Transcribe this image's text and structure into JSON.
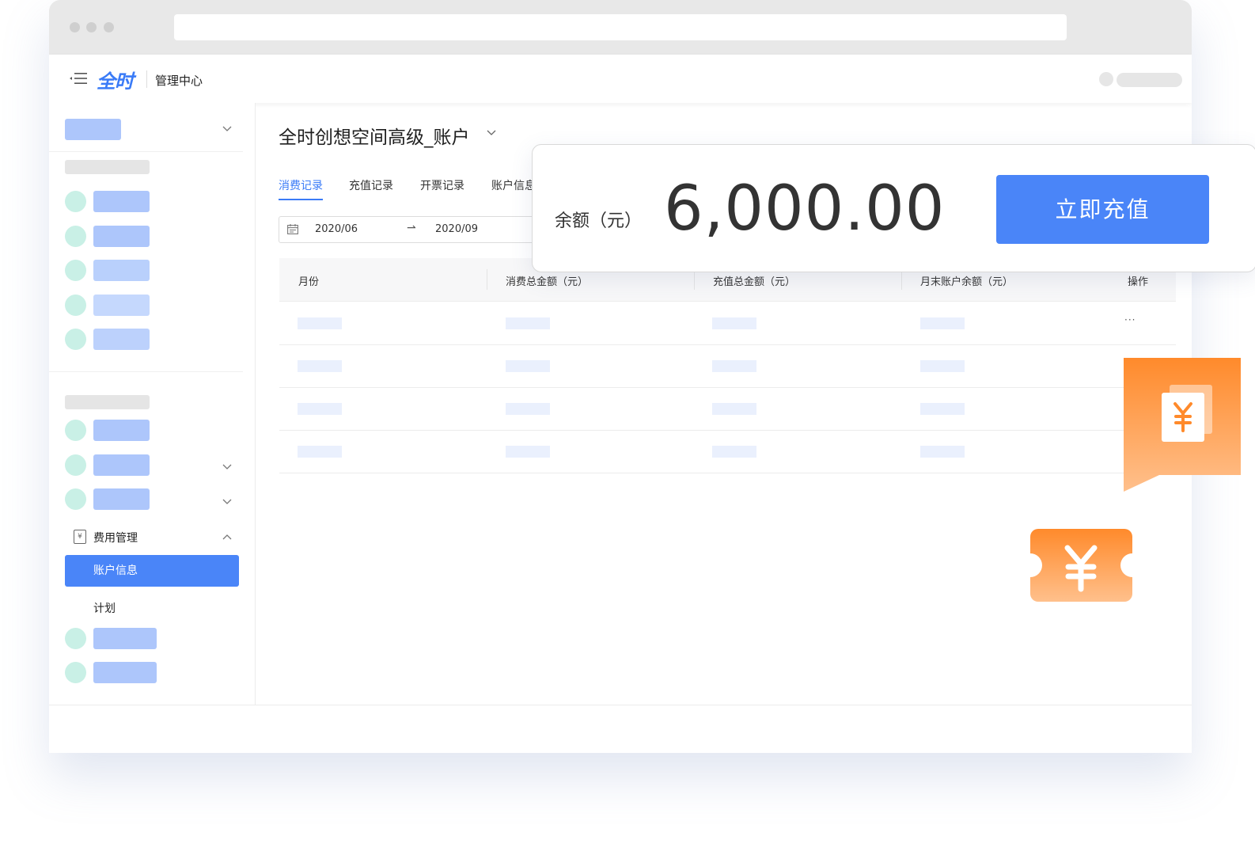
{
  "app": {
    "logo_text": "全时",
    "title": "管理中心"
  },
  "sidebar": {
    "group_label": "费用管理",
    "active_item": "账户信息",
    "plan_item": "计划"
  },
  "account": {
    "title": "全时创想空间高级_账户"
  },
  "tabs": [
    {
      "label": "消费记录",
      "active": true
    },
    {
      "label": "充值记录",
      "active": false
    },
    {
      "label": "开票记录",
      "active": false
    },
    {
      "label": "账户信息",
      "active": false
    }
  ],
  "date_range": {
    "from": "2020/06",
    "arrow": "⇀",
    "to": "2020/09"
  },
  "table": {
    "headers": [
      "月份",
      "消费总金额（元）",
      "充值总金额（元）",
      "月末账户余额（元）",
      "操作"
    ],
    "row_action": "···"
  },
  "balance": {
    "label": "余额（元）",
    "value": "6,000.00",
    "button": "立即充值"
  },
  "icons": {
    "receipt": "yen-receipt-icon",
    "coupon": "yen-coupon-icon"
  },
  "colors": {
    "accent": "#4a85f8",
    "orange": "#ff8a2b"
  }
}
